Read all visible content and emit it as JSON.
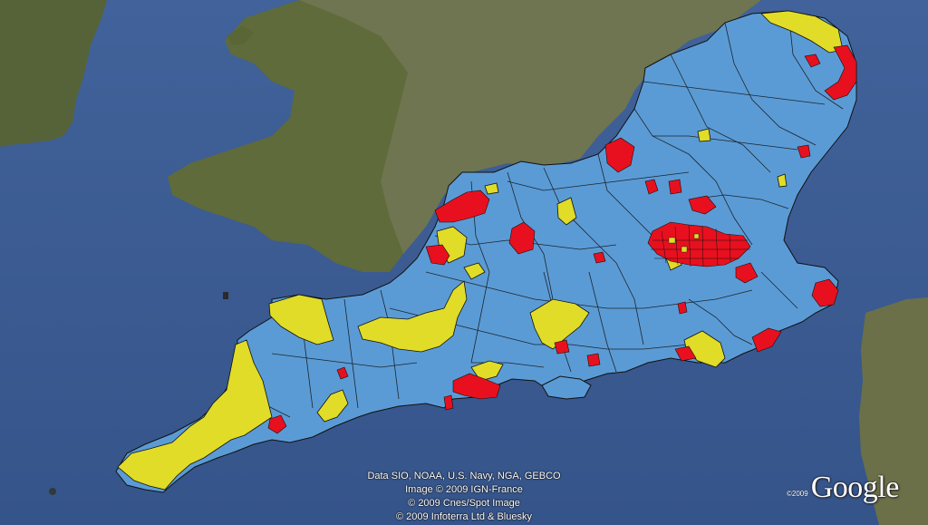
{
  "map": {
    "attribution": [
      "Data SIO, NOAA, U.S. Navy, NGA, GEBCO",
      "Image © 2009 IGN-France",
      "© 2009 Cnes/Spot Image",
      "© 2009 Infoterra Ltd & Bluesky"
    ],
    "logo_year": "©2009",
    "logo_text": "Google",
    "colors": {
      "sea": "#3c5a8c",
      "land_wales": "#5f6b3a",
      "land_midlands": "#6e7550",
      "constituency_blue": "#5b9bd5",
      "constituency_red": "#e8101e",
      "constituency_yellow": "#e0dc28",
      "boundary": "#111111"
    },
    "legend_classes": [
      "blue",
      "red",
      "yellow"
    ]
  }
}
